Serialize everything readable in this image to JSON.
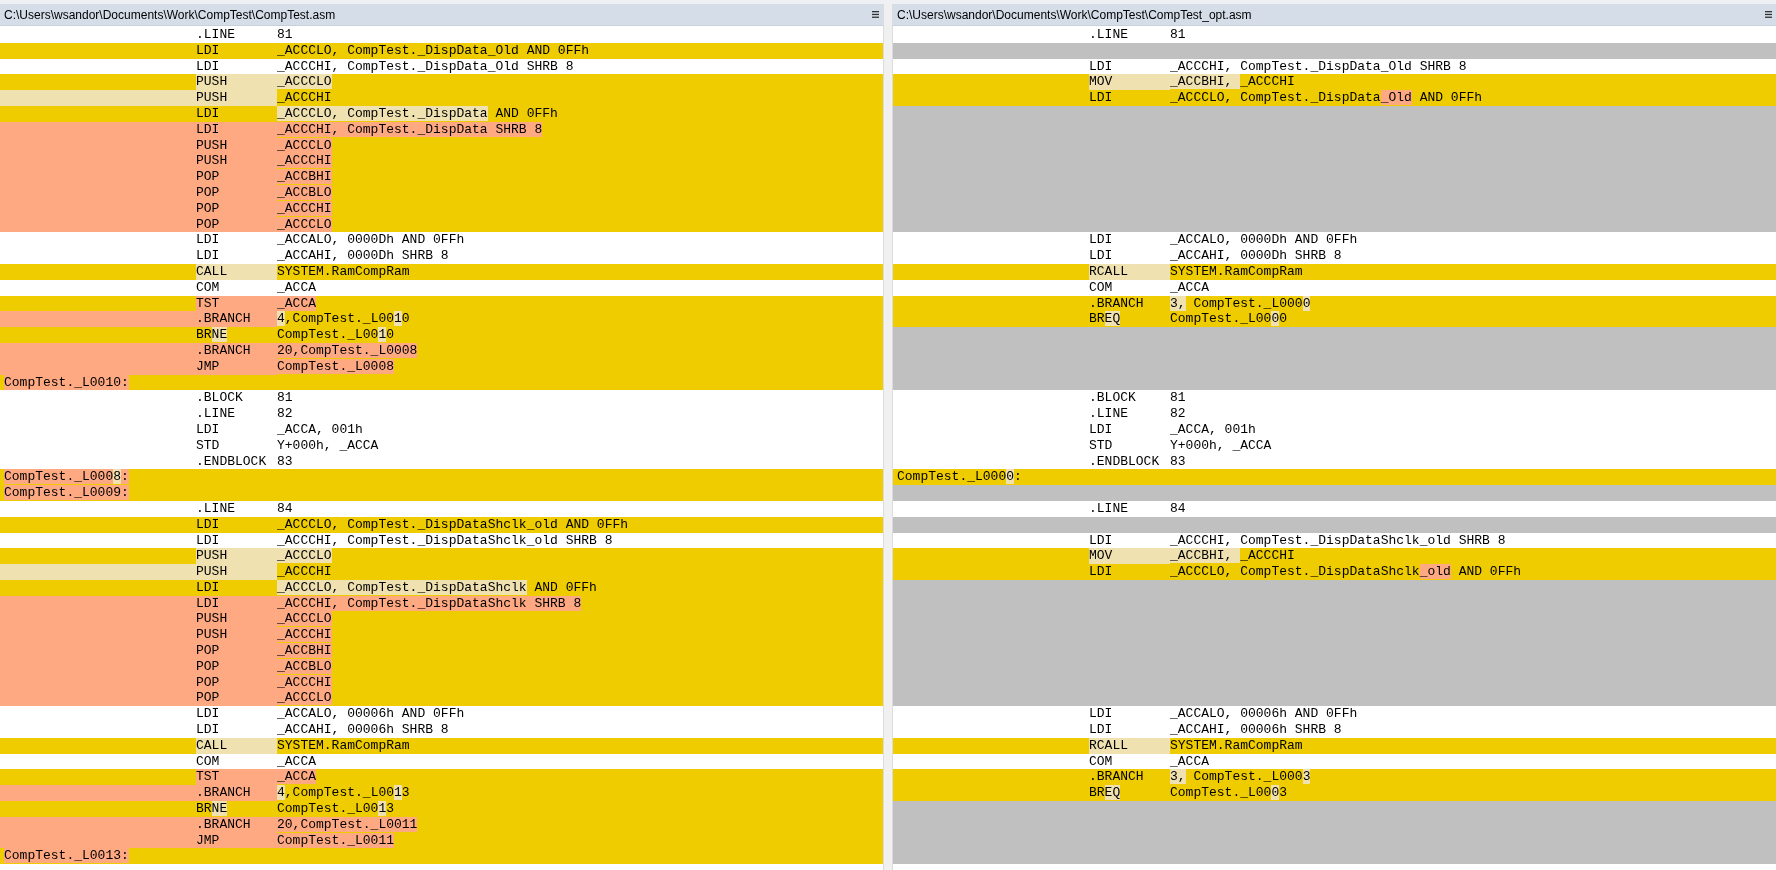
{
  "panes": [
    {
      "title": "C:\\Users\\wsandor\\Documents\\Work\\CompTest\\CompTest.asm",
      "lines": [
        {
          "kind": "equal",
          "op": ".LINE",
          "args": "81"
        },
        {
          "kind": "changed",
          "op": "LDI",
          "args": "_ACCCLO, CompTest._DispData_Old AND 0FFh"
        },
        {
          "kind": "equal",
          "op": "LDI",
          "args": "_ACCCHI, CompTest._DispData_Old SHRB 8"
        },
        {
          "kind": "changed",
          "op": {
            "kind": "moved",
            "text": "PUSH"
          },
          "args": [
            {
              "text": "_ACCCLO",
              "kind": "moved"
            }
          ]
        },
        {
          "kind": "moved",
          "op": {
            "kind": "moved",
            "text": "PUSH"
          },
          "args": "_ACCCHI"
        },
        {
          "kind": "changed",
          "op": "LDI",
          "args": [
            {
              "text": "_ACCCLO, CompTest._DispData",
              "kind": "moved"
            },
            {
              "text": " AND 0FFh"
            }
          ]
        },
        {
          "kind": "removed",
          "op": {
            "kind": "removed",
            "text": "LDI"
          },
          "args": [
            {
              "text": "_ACCCHI, CompTest._DispData SHRB 8",
              "kind": "removed"
            }
          ]
        },
        {
          "kind": "removed",
          "op": {
            "kind": "removed",
            "text": "PUSH"
          },
          "args": [
            {
              "text": "_ACCCLO",
              "kind": "removed"
            }
          ]
        },
        {
          "kind": "removed",
          "op": {
            "kind": "removed",
            "text": "PUSH"
          },
          "args": [
            {
              "text": "_ACCCHI",
              "kind": "removed"
            }
          ]
        },
        {
          "kind": "removed",
          "op": {
            "kind": "removed",
            "text": "POP"
          },
          "args": [
            {
              "text": "_ACCBHI",
              "kind": "removed"
            }
          ]
        },
        {
          "kind": "removed",
          "op": {
            "kind": "removed",
            "text": "POP"
          },
          "args": [
            {
              "text": "_ACCBLO",
              "kind": "removed"
            }
          ]
        },
        {
          "kind": "removed",
          "op": {
            "kind": "removed",
            "text": "POP"
          },
          "args": [
            {
              "text": "_ACCCHI",
              "kind": "removed"
            }
          ]
        },
        {
          "kind": "removed",
          "op": {
            "kind": "removed",
            "text": "POP"
          },
          "args": [
            {
              "text": "_ACCCLO",
              "kind": "removed"
            }
          ]
        },
        {
          "kind": "equal",
          "op": "LDI",
          "args": "_ACCALO, 0000Dh AND 0FFh"
        },
        {
          "kind": "equal",
          "op": "LDI",
          "args": "_ACCAHI, 0000Dh SHRB 8"
        },
        {
          "kind": "changed",
          "op": {
            "kind": "moved",
            "text": "CALL"
          },
          "args": "SYSTEM.RamCompRam"
        },
        {
          "kind": "equal",
          "op": "COM",
          "args": "_ACCA"
        },
        {
          "kind": "changed",
          "op": {
            "kind": "removed",
            "text": "TST"
          },
          "args": [
            {
              "text": "_ACCA",
              "kind": "removed"
            }
          ]
        },
        {
          "kind": "removed",
          "op": {
            "kind": "removed",
            "text": ".BRANCH"
          },
          "args": [
            {
              "text": "4",
              "kind": "moved"
            },
            {
              "text": ",CompTest._L00"
            },
            {
              "text": "1",
              "kind": "moved"
            },
            {
              "text": "0"
            }
          ]
        },
        {
          "kind": "changed",
          "op": [
            {
              "text": "BR"
            },
            {
              "text": "NE",
              "kind": "moved"
            }
          ],
          "args": [
            {
              "text": "CompTest._L00"
            },
            {
              "text": "1",
              "kind": "moved"
            },
            {
              "text": "0"
            }
          ]
        },
        {
          "kind": "removed",
          "op": {
            "kind": "removed",
            "text": ".BRANCH"
          },
          "args": [
            {
              "text": "20,CompTest._L0008",
              "kind": "removed"
            }
          ]
        },
        {
          "kind": "removed",
          "op": {
            "kind": "removed",
            "text": "JMP"
          },
          "args": [
            {
              "text": "CompTest._L0008",
              "kind": "removed"
            }
          ]
        },
        {
          "kind": "changed",
          "label": [
            {
              "text": "CompTest._L0010:",
              "kind": "removed"
            }
          ]
        },
        {
          "kind": "equal",
          "op": ".BLOCK",
          "args": "81"
        },
        {
          "kind": "equal",
          "op": ".LINE",
          "args": "82"
        },
        {
          "kind": "equal",
          "op": "LDI",
          "args": "_ACCA, 001h"
        },
        {
          "kind": "equal",
          "op": "STD",
          "args": "Y+000h, _ACCA"
        },
        {
          "kind": "equal",
          "op": ".ENDBLOCK",
          "args": "83"
        },
        {
          "kind": "changed",
          "label": [
            {
              "text": "CompTest._L000",
              "kind": "removed"
            },
            {
              "text": "8",
              "kind": "moved"
            },
            {
              "text": ":",
              "kind": "removed"
            }
          ]
        },
        {
          "kind": "changed",
          "label": [
            {
              "text": "CompTest._L0009:",
              "kind": "removed"
            }
          ]
        },
        {
          "kind": "equal",
          "op": ".LINE",
          "args": "84"
        },
        {
          "kind": "changed",
          "op": "LDI",
          "args": "_ACCCLO, CompTest._DispDataShclk_old AND 0FFh"
        },
        {
          "kind": "equal",
          "op": "LDI",
          "args": "_ACCCHI, CompTest._DispDataShclk_old SHRB 8"
        },
        {
          "kind": "changed",
          "op": {
            "kind": "moved",
            "text": "PUSH"
          },
          "args": [
            {
              "text": "_ACCCLO",
              "kind": "moved"
            }
          ]
        },
        {
          "kind": "moved",
          "op": {
            "kind": "moved",
            "text": "PUSH"
          },
          "args": "_ACCCHI"
        },
        {
          "kind": "changed",
          "op": "LDI",
          "args": [
            {
              "text": "_ACCCLO, CompTest._DispDataShclk",
              "kind": "moved"
            },
            {
              "text": " AND 0FFh"
            }
          ]
        },
        {
          "kind": "removed",
          "op": {
            "kind": "removed",
            "text": "LDI"
          },
          "args": [
            {
              "text": "_ACCCHI, CompTest._DispDataShclk SHRB 8",
              "kind": "removed"
            }
          ]
        },
        {
          "kind": "removed",
          "op": {
            "kind": "removed",
            "text": "PUSH"
          },
          "args": [
            {
              "text": "_ACCCLO",
              "kind": "removed"
            }
          ]
        },
        {
          "kind": "removed",
          "op": {
            "kind": "removed",
            "text": "PUSH"
          },
          "args": [
            {
              "text": "_ACCCHI",
              "kind": "removed"
            }
          ]
        },
        {
          "kind": "removed",
          "op": {
            "kind": "removed",
            "text": "POP"
          },
          "args": [
            {
              "text": "_ACCBHI",
              "kind": "removed"
            }
          ]
        },
        {
          "kind": "removed",
          "op": {
            "kind": "removed",
            "text": "POP"
          },
          "args": [
            {
              "text": "_ACCBLO",
              "kind": "removed"
            }
          ]
        },
        {
          "kind": "removed",
          "op": {
            "kind": "removed",
            "text": "POP"
          },
          "args": [
            {
              "text": "_ACCCHI",
              "kind": "removed"
            }
          ]
        },
        {
          "kind": "removed",
          "op": {
            "kind": "removed",
            "text": "POP"
          },
          "args": [
            {
              "text": "_ACCCLO",
              "kind": "removed"
            }
          ]
        },
        {
          "kind": "equal",
          "op": "LDI",
          "args": "_ACCALO, 00006h AND 0FFh"
        },
        {
          "kind": "equal",
          "op": "LDI",
          "args": "_ACCAHI, 00006h SHRB 8"
        },
        {
          "kind": "changed",
          "op": {
            "kind": "moved",
            "text": "CALL"
          },
          "args": "SYSTEM.RamCompRam"
        },
        {
          "kind": "equal",
          "op": "COM",
          "args": "_ACCA"
        },
        {
          "kind": "changed",
          "op": {
            "kind": "removed",
            "text": "TST"
          },
          "args": [
            {
              "text": "_ACCA",
              "kind": "removed"
            }
          ]
        },
        {
          "kind": "removed",
          "op": {
            "kind": "removed",
            "text": ".BRANCH"
          },
          "args": [
            {
              "text": "4",
              "kind": "moved"
            },
            {
              "text": ",CompTest._L00"
            },
            {
              "text": "1",
              "kind": "moved"
            },
            {
              "text": "3"
            }
          ]
        },
        {
          "kind": "changed",
          "op": [
            {
              "text": "BR"
            },
            {
              "text": "NE",
              "kind": "moved"
            }
          ],
          "args": [
            {
              "text": "CompTest._L00"
            },
            {
              "text": "1",
              "kind": "moved"
            },
            {
              "text": "3"
            }
          ]
        },
        {
          "kind": "removed",
          "op": {
            "kind": "removed",
            "text": ".BRANCH"
          },
          "args": [
            {
              "text": "20,CompTest._L0011",
              "kind": "removed"
            }
          ]
        },
        {
          "kind": "removed",
          "op": {
            "kind": "removed",
            "text": "JMP"
          },
          "args": [
            {
              "text": "CompTest._L0011",
              "kind": "removed"
            }
          ]
        },
        {
          "kind": "changed",
          "label": [
            {
              "text": "CompTest._L0013:",
              "kind": "removed"
            }
          ]
        }
      ]
    },
    {
      "title": "C:\\Users\\wsandor\\Documents\\Work\\CompTest\\CompTest_opt.asm",
      "lines": [
        {
          "kind": "equal",
          "op": ".LINE",
          "args": "81"
        },
        {
          "kind": "filler"
        },
        {
          "kind": "equal",
          "op": "LDI",
          "args": "_ACCCHI, CompTest._DispData_Old SHRB 8"
        },
        {
          "kind": "changed",
          "op": {
            "kind": "moved",
            "text": "MOV"
          },
          "args": [
            {
              "text": "_ACCBHI, ",
              "kind": "moved"
            },
            {
              "text": "_ACCCHI"
            }
          ]
        },
        {
          "kind": "changed",
          "op": "LDI",
          "args": [
            {
              "text": "_ACCCLO, CompTest._DispData"
            },
            {
              "text": "_Old",
              "kind": "removed"
            },
            {
              "text": " AND 0FFh"
            }
          ]
        },
        {
          "kind": "filler"
        },
        {
          "kind": "filler"
        },
        {
          "kind": "filler"
        },
        {
          "kind": "filler"
        },
        {
          "kind": "filler"
        },
        {
          "kind": "filler"
        },
        {
          "kind": "filler"
        },
        {
          "kind": "filler"
        },
        {
          "kind": "equal",
          "op": "LDI",
          "args": "_ACCALO, 0000Dh AND 0FFh"
        },
        {
          "kind": "equal",
          "op": "LDI",
          "args": "_ACCAHI, 0000Dh SHRB 8"
        },
        {
          "kind": "changed",
          "op": {
            "kind": "moved",
            "text": "RCALL"
          },
          "args": "SYSTEM.RamCompRam"
        },
        {
          "kind": "equal",
          "op": "COM",
          "args": "_ACCA"
        },
        {
          "kind": "changed",
          "op": ".BRANCH",
          "args": [
            {
              "text": "3,",
              "kind": "moved"
            },
            {
              "text": " CompTest._L000"
            },
            {
              "text": "0",
              "kind": "moved"
            }
          ]
        },
        {
          "kind": "changed",
          "op": [
            {
              "text": "BR"
            },
            {
              "text": "EQ",
              "kind": "moved"
            }
          ],
          "args": [
            {
              "text": "CompTest._L00"
            },
            {
              "text": "0",
              "kind": "moved"
            },
            {
              "text": "0"
            }
          ]
        },
        {
          "kind": "filler"
        },
        {
          "kind": "filler"
        },
        {
          "kind": "filler"
        },
        {
          "kind": "filler"
        },
        {
          "kind": "equal",
          "op": ".BLOCK",
          "args": "81"
        },
        {
          "kind": "equal",
          "op": ".LINE",
          "args": "82"
        },
        {
          "kind": "equal",
          "op": "LDI",
          "args": "_ACCA, 001h"
        },
        {
          "kind": "equal",
          "op": "STD",
          "args": "Y+000h, _ACCA"
        },
        {
          "kind": "equal",
          "op": ".ENDBLOCK",
          "args": "83"
        },
        {
          "kind": "changed",
          "label": [
            {
              "text": "CompTest._L000"
            },
            {
              "text": "0",
              "kind": "moved"
            },
            {
              "text": ":"
            }
          ]
        },
        {
          "kind": "filler"
        },
        {
          "kind": "equal",
          "op": ".LINE",
          "args": "84"
        },
        {
          "kind": "filler"
        },
        {
          "kind": "equal",
          "op": "LDI",
          "args": "_ACCCHI, CompTest._DispDataShclk_old SHRB 8"
        },
        {
          "kind": "changed",
          "op": {
            "kind": "moved",
            "text": "MOV"
          },
          "args": [
            {
              "text": "_ACCBHI, ",
              "kind": "moved"
            },
            {
              "text": "_ACCCHI"
            }
          ]
        },
        {
          "kind": "changed",
          "op": "LDI",
          "args": [
            {
              "text": "_ACCCLO, CompTest._DispDataShclk"
            },
            {
              "text": "_old",
              "kind": "removed"
            },
            {
              "text": " AND 0FFh"
            }
          ]
        },
        {
          "kind": "filler"
        },
        {
          "kind": "filler"
        },
        {
          "kind": "filler"
        },
        {
          "kind": "filler"
        },
        {
          "kind": "filler"
        },
        {
          "kind": "filler"
        },
        {
          "kind": "filler"
        },
        {
          "kind": "filler"
        },
        {
          "kind": "equal",
          "op": "LDI",
          "args": "_ACCALO, 00006h AND 0FFh"
        },
        {
          "kind": "equal",
          "op": "LDI",
          "args": "_ACCAHI, 00006h SHRB 8"
        },
        {
          "kind": "changed",
          "op": {
            "kind": "moved",
            "text": "RCALL"
          },
          "args": "SYSTEM.RamCompRam"
        },
        {
          "kind": "equal",
          "op": "COM",
          "args": "_ACCA"
        },
        {
          "kind": "changed",
          "op": ".BRANCH",
          "args": [
            {
              "text": "3,",
              "kind": "moved"
            },
            {
              "text": " CompTest._L000"
            },
            {
              "text": "3",
              "kind": "moved"
            }
          ]
        },
        {
          "kind": "changed",
          "op": [
            {
              "text": "BR"
            },
            {
              "text": "EQ",
              "kind": "moved"
            }
          ],
          "args": [
            {
              "text": "CompTest._L00"
            },
            {
              "text": "0",
              "kind": "moved"
            },
            {
              "text": "3"
            }
          ]
        },
        {
          "kind": "filler"
        },
        {
          "kind": "filler"
        },
        {
          "kind": "filler"
        },
        {
          "kind": "filler"
        }
      ]
    }
  ]
}
